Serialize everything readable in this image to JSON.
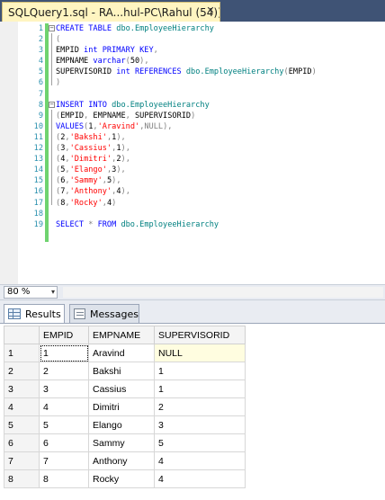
{
  "tab": {
    "title": "SQLQuery1.sql - RA...hul-PC\\Rahul (54))*",
    "close": "✕"
  },
  "editor": {
    "line_numbers": [
      "1",
      "2",
      "3",
      "4",
      "5",
      "6",
      "7",
      "8",
      "9",
      "10",
      "11",
      "12",
      "13",
      "14",
      "15",
      "16",
      "17",
      "18",
      "19"
    ],
    "collapse_glyph": "−",
    "lines": [
      [
        [
          "kw",
          "CREATE TABLE "
        ],
        [
          "obj",
          "dbo.EmployeeHierarchy"
        ]
      ],
      [
        [
          "gr",
          "("
        ]
      ],
      [
        [
          "",
          "EMPID "
        ],
        [
          "kw",
          "int PRIMARY KEY"
        ],
        [
          "gr",
          ","
        ]
      ],
      [
        [
          "",
          "EMPNAME "
        ],
        [
          "kw",
          "varchar"
        ],
        [
          "gr",
          "("
        ],
        [
          "",
          "50"
        ],
        [
          "gr",
          "),"
        ]
      ],
      [
        [
          "",
          "SUPERVISORID "
        ],
        [
          "kw",
          "int REFERENCES "
        ],
        [
          "obj",
          "dbo.EmployeeHierarchy"
        ],
        [
          "gr",
          "("
        ],
        [
          "",
          "EMPID"
        ],
        [
          "gr",
          ")"
        ]
      ],
      [
        [
          "gr",
          ")"
        ]
      ],
      [],
      [
        [
          "kw",
          "INSERT INTO "
        ],
        [
          "obj",
          "dbo.EmployeeHierarchy"
        ]
      ],
      [
        [
          "gr",
          "("
        ],
        [
          "",
          "EMPID"
        ],
        [
          "gr",
          ", "
        ],
        [
          "",
          "EMPNAME"
        ],
        [
          "gr",
          ", "
        ],
        [
          "",
          "SUPERVISORID"
        ],
        [
          "gr",
          ")"
        ]
      ],
      [
        [
          "kw",
          "VALUES"
        ],
        [
          "gr",
          "("
        ],
        [
          "",
          "1"
        ],
        [
          "gr",
          ","
        ],
        [
          "str",
          "'Aravind'"
        ],
        [
          "gr",
          ","
        ],
        [
          "gr",
          "NULL"
        ],
        [
          "gr",
          "),"
        ]
      ],
      [
        [
          "gr",
          "("
        ],
        [
          "",
          "2"
        ],
        [
          "gr",
          ","
        ],
        [
          "str",
          "'Bakshi'"
        ],
        [
          "gr",
          ","
        ],
        [
          "",
          "1"
        ],
        [
          "gr",
          "),"
        ]
      ],
      [
        [
          "gr",
          "("
        ],
        [
          "",
          "3"
        ],
        [
          "gr",
          ","
        ],
        [
          "str",
          "'Cassius'"
        ],
        [
          "gr",
          ","
        ],
        [
          "",
          "1"
        ],
        [
          "gr",
          "),"
        ]
      ],
      [
        [
          "gr",
          "("
        ],
        [
          "",
          "4"
        ],
        [
          "gr",
          ","
        ],
        [
          "str",
          "'Dimitri'"
        ],
        [
          "gr",
          ","
        ],
        [
          "",
          "2"
        ],
        [
          "gr",
          "),"
        ]
      ],
      [
        [
          "gr",
          "("
        ],
        [
          "",
          "5"
        ],
        [
          "gr",
          ","
        ],
        [
          "str",
          "'Elango'"
        ],
        [
          "gr",
          ","
        ],
        [
          "",
          "3"
        ],
        [
          "gr",
          "),"
        ]
      ],
      [
        [
          "gr",
          "("
        ],
        [
          "",
          "6"
        ],
        [
          "gr",
          ","
        ],
        [
          "str",
          "'Sammy'"
        ],
        [
          "gr",
          ","
        ],
        [
          "",
          "5"
        ],
        [
          "gr",
          "),"
        ]
      ],
      [
        [
          "gr",
          "("
        ],
        [
          "",
          "7"
        ],
        [
          "gr",
          ","
        ],
        [
          "str",
          "'Anthony'"
        ],
        [
          "gr",
          ","
        ],
        [
          "",
          "4"
        ],
        [
          "gr",
          "),"
        ]
      ],
      [
        [
          "gr",
          "("
        ],
        [
          "",
          "8"
        ],
        [
          "gr",
          ","
        ],
        [
          "str",
          "'Rocky'"
        ],
        [
          "gr",
          ","
        ],
        [
          "",
          "4"
        ],
        [
          "gr",
          ")"
        ]
      ],
      [],
      [
        [
          "kw",
          "SELECT "
        ],
        [
          "gr",
          "* "
        ],
        [
          "kw",
          "FROM "
        ],
        [
          "obj",
          "dbo.EmployeeHierarchy"
        ]
      ]
    ]
  },
  "zoom": {
    "value": "80 %",
    "chevron": "▾"
  },
  "results": {
    "tabs": [
      {
        "label": "Results",
        "icon": "grid-icon"
      },
      {
        "label": "Messages",
        "icon": "messages-icon"
      }
    ],
    "columns": [
      "",
      "EMPID",
      "EMPNAME",
      "SUPERVISORID"
    ],
    "rows": [
      [
        "1",
        "1",
        "Aravind",
        "NULL"
      ],
      [
        "2",
        "2",
        "Bakshi",
        "1"
      ],
      [
        "3",
        "3",
        "Cassius",
        "1"
      ],
      [
        "4",
        "4",
        "Dimitri",
        "2"
      ],
      [
        "5",
        "5",
        "Elango",
        "3"
      ],
      [
        "6",
        "6",
        "Sammy",
        "5"
      ],
      [
        "7",
        "7",
        "Anthony",
        "4"
      ],
      [
        "8",
        "8",
        "Rocky",
        "4"
      ]
    ]
  },
  "colors": {
    "tabstrip": "#3f5375",
    "active_tab": "#fff5c1",
    "keyword": "#0000ff",
    "string": "#ff0000",
    "object": "#008080",
    "line_number": "#2b91af",
    "change_bar": "#6fd36f"
  }
}
